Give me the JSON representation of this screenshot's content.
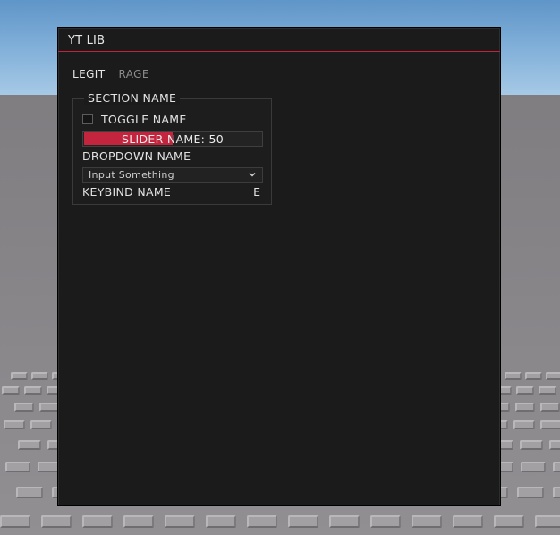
{
  "window": {
    "title": "YT LIB",
    "accent_color": "#c4253e"
  },
  "tabs": [
    {
      "label": "LEGIT",
      "active": true
    },
    {
      "label": "RAGE",
      "active": false
    }
  ],
  "section": {
    "title": "SECTION NAME",
    "toggle": {
      "label": "TOGGLE NAME",
      "checked": false
    },
    "slider": {
      "label": "SLIDER NAME: 50",
      "value": 50,
      "min": 0,
      "max": 100
    },
    "dropdown": {
      "label": "DROPDOWN NAME",
      "value": "Input Something",
      "icon": "chevron-down-icon"
    },
    "keybind": {
      "label": "KEYBIND NAME",
      "key": "E"
    }
  }
}
